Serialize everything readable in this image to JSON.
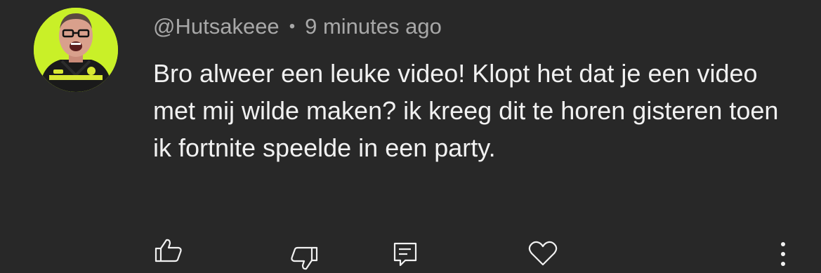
{
  "comment": {
    "author": "@Hutsakeee",
    "separator": "•",
    "timestamp": "9 minutes ago",
    "text": "Bro alweer een leuke video! Klopt het dat je een video met mij wilde maken? ik kreeg dit te horen gisteren toen ik fortnite speelde in een party."
  },
  "actions": {
    "like_icon": "thumbs-up-icon",
    "dislike_icon": "thumbs-down-icon",
    "reply_icon": "reply-icon",
    "heart_icon": "heart-icon",
    "more_icon": "more-vertical-icon"
  },
  "colors": {
    "background": "#282828",
    "text_primary": "#f1f1f1",
    "text_secondary": "#a8a8a8",
    "avatar_bg": "#c9f028"
  }
}
